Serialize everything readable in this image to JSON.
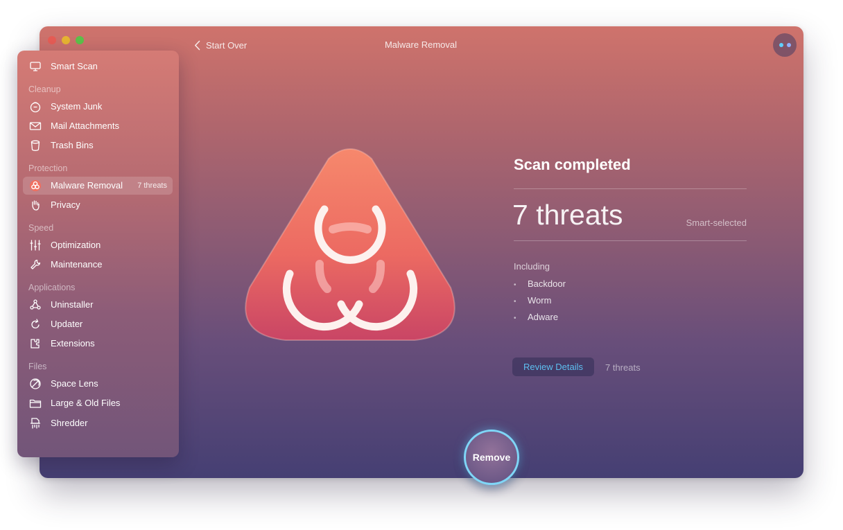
{
  "window": {
    "title": "Malware Removal",
    "back_label": "Start Over",
    "assistant_dot_colors": [
      "#5fd0ff",
      "#8fb0ff"
    ]
  },
  "sidebar": {
    "items": [
      {
        "label": "Smart Scan",
        "icon": "monitor-icon"
      },
      {
        "label": "System Junk",
        "icon": "junk-icon"
      },
      {
        "label": "Mail Attachments",
        "icon": "mail-icon"
      },
      {
        "label": "Trash Bins",
        "icon": "trash-icon"
      },
      {
        "label": "Malware Removal",
        "icon": "biohazard-icon",
        "badge": "7 threats",
        "active": true
      },
      {
        "label": "Privacy",
        "icon": "hand-icon"
      },
      {
        "label": "Optimization",
        "icon": "sliders-icon"
      },
      {
        "label": "Maintenance",
        "icon": "wrench-icon"
      },
      {
        "label": "Uninstaller",
        "icon": "uninstaller-icon"
      },
      {
        "label": "Updater",
        "icon": "updater-icon"
      },
      {
        "label": "Extensions",
        "icon": "extensions-icon"
      },
      {
        "label": "Space Lens",
        "icon": "lens-icon"
      },
      {
        "label": "Large & Old Files",
        "icon": "folder-icon"
      },
      {
        "label": "Shredder",
        "icon": "shredder-icon"
      }
    ],
    "sections": {
      "cleanup": "Cleanup",
      "protection": "Protection",
      "speed": "Speed",
      "applications": "Applications",
      "files": "Files"
    }
  },
  "result": {
    "title": "Scan completed",
    "count": "7 threats",
    "smart_selected": "Smart-selected",
    "including": "Including",
    "threats": [
      "Backdoor",
      "Worm",
      "Adware"
    ]
  },
  "review": {
    "button_label": "Review Details",
    "count": "7 threats"
  },
  "remove_button": "Remove",
  "colors": {
    "accent_link": "#5dbff0",
    "remove_ring": "#7fd6f7",
    "hero_top": "#f6876c",
    "hero_bottom": "#c94565"
  }
}
